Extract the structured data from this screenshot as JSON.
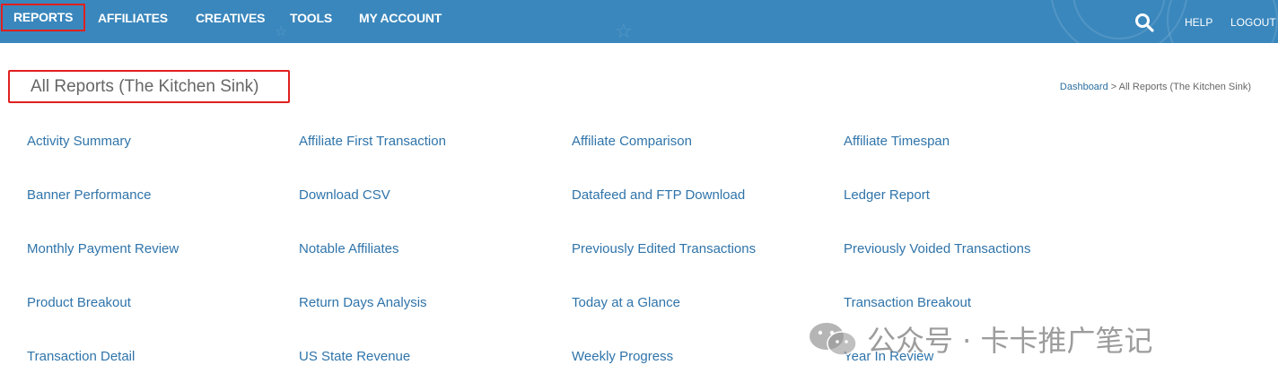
{
  "nav": {
    "items": [
      "REPORTS",
      "AFFILIATES",
      "CREATIVES",
      "TOOLS",
      "MY ACCOUNT"
    ],
    "help": "HELP",
    "logout": "LOGOUT"
  },
  "page": {
    "title": "All Reports (The Kitchen Sink)",
    "breadcrumb_home": "Dashboard",
    "breadcrumb_sep": " > ",
    "breadcrumb_current": "All Reports (The Kitchen Sink)"
  },
  "reports": [
    [
      "Activity Summary",
      "Affiliate First Transaction",
      "Affiliate Comparison",
      "Affiliate Timespan"
    ],
    [
      "Banner Performance",
      "Download CSV",
      "Datafeed and FTP Download",
      "Ledger Report"
    ],
    [
      "Monthly Payment Review",
      "Notable Affiliates",
      "Previously Edited Transactions",
      "Previously Voided Transactions"
    ],
    [
      "Product Breakout",
      "Return Days Analysis",
      "Today at a Glance",
      "Transaction Breakout"
    ],
    [
      "Transaction Detail",
      "US State Revenue",
      "Weekly Progress",
      "Year In Review"
    ]
  ],
  "watermark": "公众号 · 卡卡推广笔记",
  "colors": {
    "nav_bg": "#3a87bd",
    "link": "#2f74aa",
    "highlight": "#e02020"
  }
}
